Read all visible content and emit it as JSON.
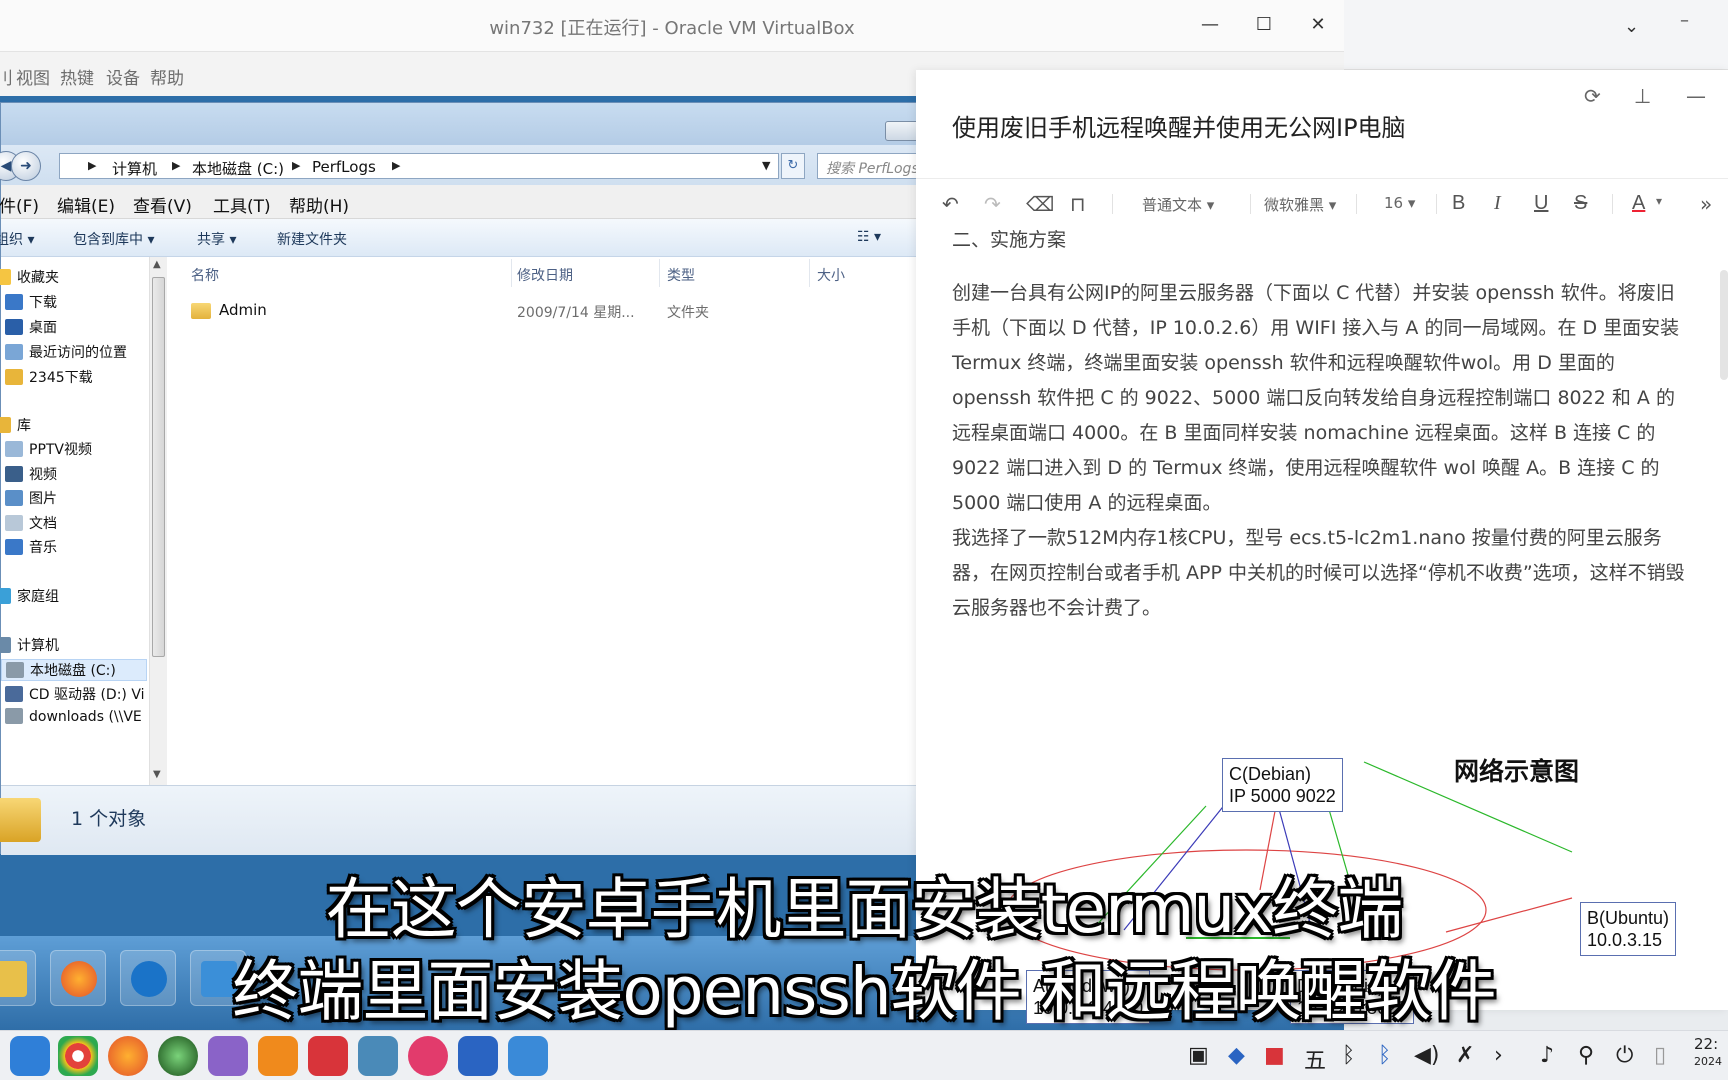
{
  "vbox": {
    "title": "win732 [正在运行] - Oracle VM VirtualBox",
    "menu": [
      "刂",
      "视图",
      "热键",
      "设备",
      "帮助"
    ]
  },
  "explorer": {
    "address": {
      "crumbs": [
        "计算机",
        "本地磁盘 (C:)",
        "PerfLogs"
      ],
      "search_placeholder": "搜索 PerfLogs"
    },
    "menubar": [
      "件(F)",
      "编辑(E)",
      "查看(V)",
      "工具(T)",
      "帮助(H)"
    ],
    "toolbar": [
      "组织 ▾",
      "包含到库中 ▾",
      "共享 ▾",
      "新建文件夹"
    ],
    "nav": [
      {
        "label": "收藏夹",
        "color": "#f5c542"
      },
      {
        "label": "下载",
        "color": "#3a78c8"
      },
      {
        "label": "桌面",
        "color": "#2a5fa8"
      },
      {
        "label": "最近访问的位置",
        "color": "#7aa6d6"
      },
      {
        "label": "2345下载",
        "color": "#e8b53a"
      },
      {
        "label": "库",
        "color": "#e8b53a"
      },
      {
        "label": "PPTV视频",
        "color": "#9ab8d8"
      },
      {
        "label": "视频",
        "color": "#3a5f8a"
      },
      {
        "label": "图片",
        "color": "#5a8fc8"
      },
      {
        "label": "文档",
        "color": "#b8c8d8"
      },
      {
        "label": "音乐",
        "color": "#3a78c8"
      },
      {
        "label": "家庭组",
        "color": "#3aa0d8"
      },
      {
        "label": "计算机",
        "color": "#6a8aa8"
      },
      {
        "label": "本地磁盘 (C:)",
        "color": "#8a9aa8"
      },
      {
        "label": "CD 驱动器 (D:) Vi",
        "color": "#4a6a9a"
      },
      {
        "label": "downloads (\\\\VE",
        "color": "#8a9aa8"
      }
    ],
    "columns": [
      "名称",
      "修改日期",
      "类型",
      "大小"
    ],
    "rows": [
      {
        "name": "Admin",
        "date": "2009/7/14 星期...",
        "type": "文件夹",
        "size": ""
      }
    ],
    "status": "1 个对象"
  },
  "note": {
    "title": "使用废旧手机远程唤醒并使用无公网IP电脑",
    "toolbar": {
      "style": "普通文本",
      "font": "微软雅黑",
      "size": "16",
      "bold": "B",
      "italic": "I",
      "underline": "U",
      "strike": "S",
      "color": "A",
      "more": "»"
    },
    "heading": "二、实施方案",
    "para1": "创建一台具有公网IP的阿里云服务器（下面以 C 代替）并安装 openssh 软件。将废旧手机（下面以 D 代替，IP 10.0.2.6）用 WIFI 接入与 A 的同一局域网。在 D 里面安装 Termux 终端，终端里面安装 openssh 软件和远程唤醒软件wol。用 D 里面的 openssh 软件把 C 的 9022、5000 端口反向转发给自身远程控制端口 8022 和 A 的远程桌面端口 4000。在 B 里面同样安装 nomachine 远程桌面。这样 B 连接 C 的 9022 端口进入到 D 的 Termux 终端，使用远程唤醒软件 wol 唤醒 A。B 连接 C 的 5000 端口使用 A 的远程桌面。",
    "para2": "我选择了一款512M内存1核CPU，型号 ecs.t5-lc2m1.nano 按量付费的阿里云服务器，在网页控制台或者手机 APP 中关机的时候可以选择“停机不收费”选项，这样不销毁云服务器也不会计费了。",
    "diagram": {
      "title": "网络示意图",
      "c_line1": "C(Debian)",
      "c_line2": "IP 5000 9022",
      "b_line1": "B(Ubuntu)",
      "b_line2": "10.0.3.15",
      "a_line1": "A(Windows)",
      "a_line2": "10.0.2.9:4000",
      "d_line1": "D(Android)",
      "d_line2": "10.0.2.6:8022"
    }
  },
  "subtitles": [
    "在这个安卓手机里面安装termux终端",
    "终端里面安装openssh软件 和远程唤醒软件"
  ],
  "dock": {
    "clock_time": "22:",
    "clock_date": "2024"
  },
  "colors": {
    "accent": "#3a78c8",
    "subtitle": "#ffffff"
  }
}
